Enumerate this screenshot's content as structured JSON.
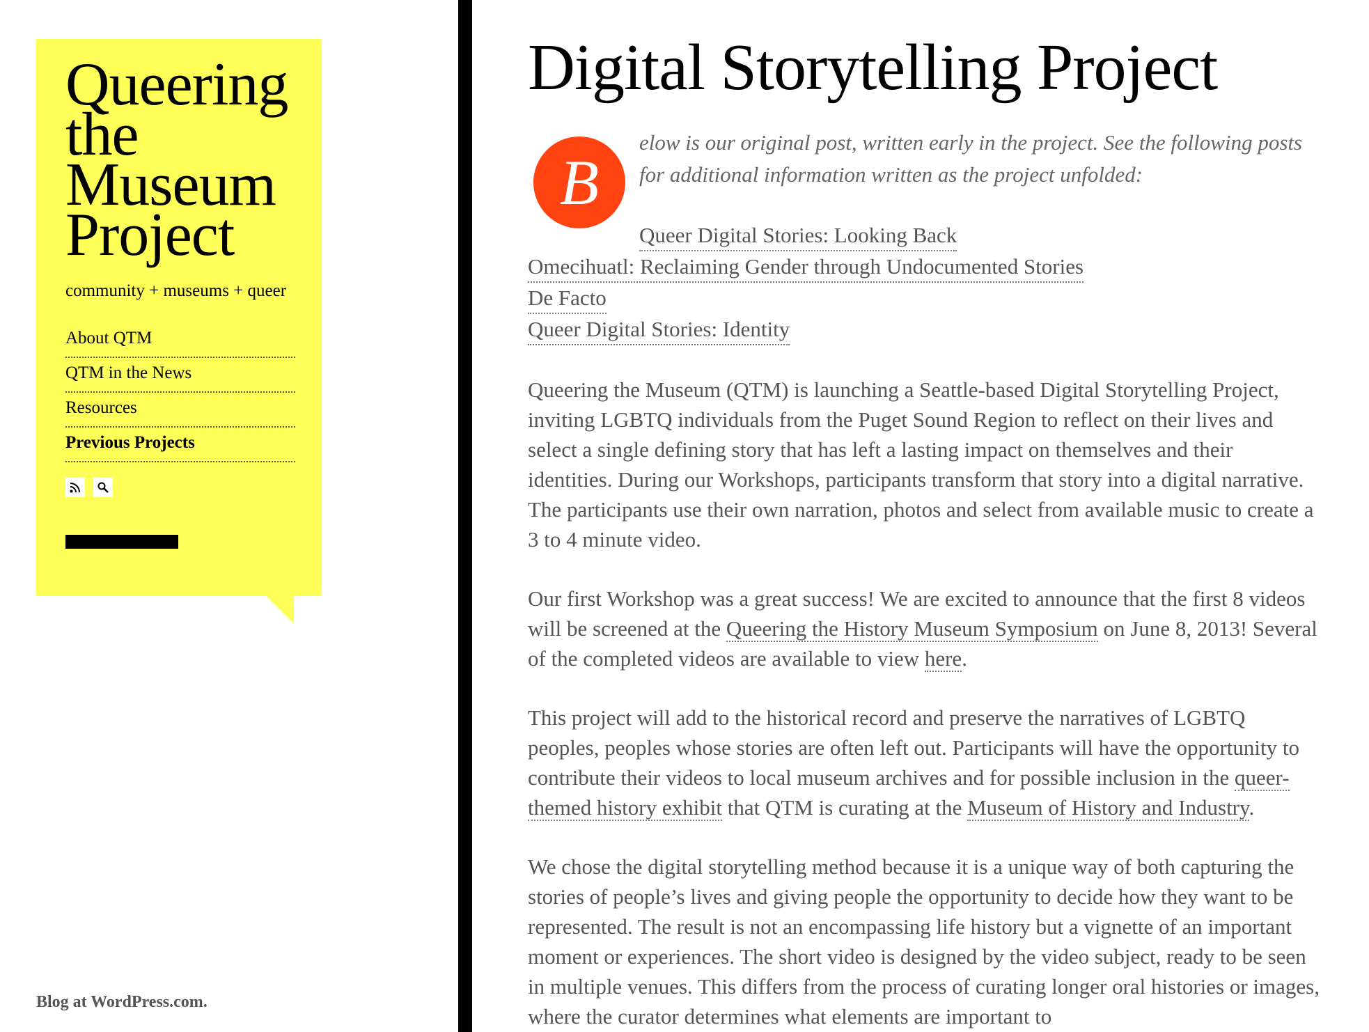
{
  "sidebar": {
    "title": "Queering the Museum Project",
    "tagline": "community + museums + queer",
    "nav": [
      {
        "label": "About QTM"
      },
      {
        "label": "QTM in the News"
      },
      {
        "label": "Resources"
      },
      {
        "label": "Previous Projects",
        "current": true
      }
    ],
    "social_icons": [
      "rss-icon",
      "search-icon"
    ],
    "colors": {
      "background": "#ffff59",
      "text": "#000000"
    }
  },
  "footer": {
    "credit": "Blog at WordPress.com."
  },
  "post": {
    "title": "Digital Storytelling Project",
    "dropcap": "B",
    "dropcap_color": "#ff4411",
    "intro": "elow is our original post, written early in the project. See the following posts for additional information written as the project unfolded:",
    "related_links": [
      "Queer Digital Stories: Looking Back",
      "Omecihuatl: Reclaiming Gender through Undocumented Stories",
      "De Facto",
      "Queer Digital Stories: Identity"
    ],
    "paragraph1": "Queering the Museum (QTM) is launching a Seattle-based Digital Storytelling Project, inviting LGBTQ individuals from the Puget Sound Region to reflect on their lives and select a single defining story that has left a lasting impact on themselves and their identities.  During our Workshops, participants transform that story into a digital narrative. The participants use their own narration, photos and select from available music to create a 3 to 4 minute video.",
    "paragraph2": {
      "part1": "Our first Workshop was a great success!  We are excited to announce that the first 8 videos will be screened at the ",
      "link1": "Queering the History Museum Symposium",
      "part2": " on June 8, 2013!  Several of the completed videos are available to view ",
      "link2": "here",
      "part3": "."
    },
    "paragraph3": {
      "part1": "This project will add to the historical record and preserve the narratives of LGBTQ peoples, peoples whose stories are often left out.  Participants will have the opportunity to contribute their videos to local museum archives and for possible inclusion in the ",
      "link1": "queer-themed history exhibit",
      "part2": " that QTM is curating at the ",
      "link2": "Museum of History and Industry",
      "part3": "."
    },
    "paragraph4": "We chose the digital storytelling method because it is a unique way of both capturing the stories of people’s lives and giving people the opportunity to decide how they want to be represented.  The result is not an encompassing life history but a vignette of an important moment or experiences.  The short video is designed by the video subject, ready to be seen in multiple venues.  This differs from the process of curating longer oral histories or images, where the curator determines what elements are important to"
  }
}
